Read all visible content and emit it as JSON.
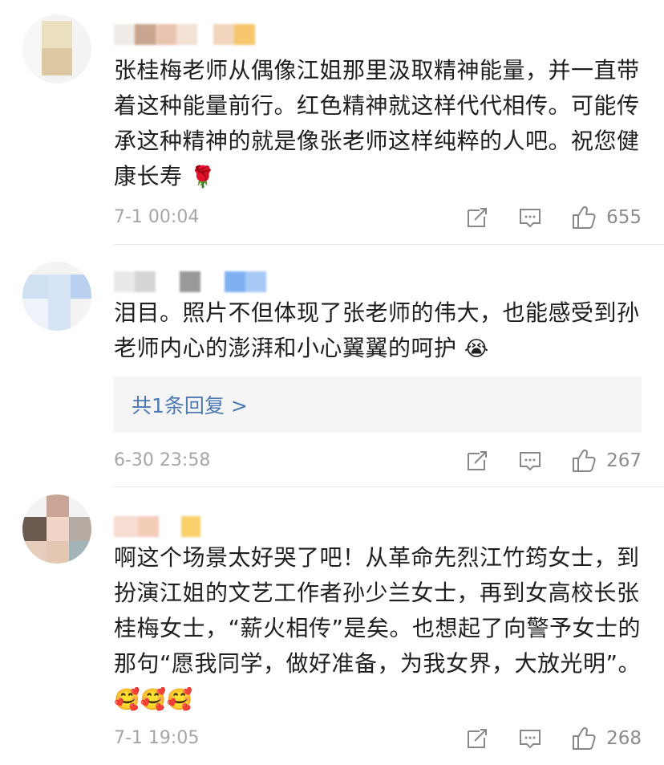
{
  "comments": [
    {
      "text": "张桂梅老师从偶像江姐那里汲取精神能量，并一直带着这种能量前行。红色精神就这样代代相传。可能传承这种精神的就是像张老师这样纯粹的人吧。祝您健康长寿",
      "emoji_icon": "rose-icon",
      "emoji": "🌹",
      "time": "7-1 00:04",
      "likes": "655",
      "reply_link": ""
    },
    {
      "text": "泪目。照片不但体现了张老师的伟大，也能感受到孙老师内心的澎湃和小心翼翼的呵护",
      "emoji_icon": "crying-face-icon",
      "emoji": "😭",
      "time": "6-30 23:58",
      "likes": "267",
      "reply_link": "共1条回复 >"
    },
    {
      "text": "啊这个场景太好哭了吧！从革命先烈江竹筠女士，到扮演江姐的文艺工作者孙少兰女士，再到女高校长张桂梅女士，“薪火相传”是矣。也想起了向警予女士的那句“愿我同学，做好准备，为我女界，大放光明”。",
      "emoji_icon": "hugging-face-icon",
      "emoji": "🥰🥰🥰",
      "time": "7-1 19:05",
      "likes": "268",
      "reply_link": ""
    }
  ],
  "colors": {
    "link": "#4a79b3",
    "meta": "#a6a6a6",
    "reply_bg": "#f5f5f5"
  }
}
